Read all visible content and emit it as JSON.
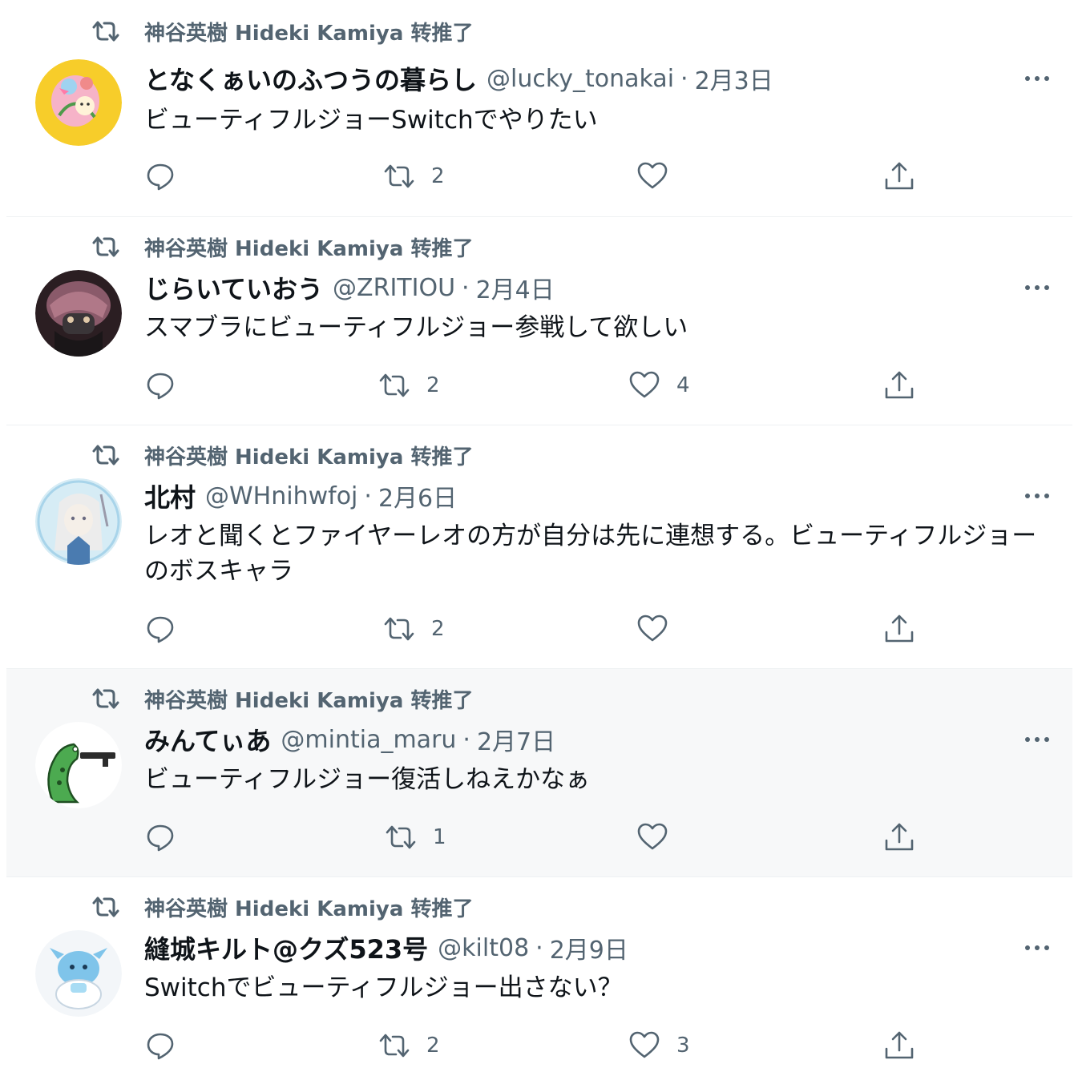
{
  "colors": {
    "secondary_text": "#536471",
    "primary_text": "#0f1419",
    "divider": "#eef1f3",
    "hover_bg": "#f7f8f9"
  },
  "icons": {
    "retweet": "retweet-icon",
    "reply": "reply-icon",
    "like": "heart-icon",
    "share": "share-icon",
    "more": "more-icon"
  },
  "tweets": [
    {
      "retweeted_by": "神谷英樹 Hideki Kamiya 转推了",
      "display_name": "となくぁいのふつうの暮らし",
      "handle": "@lucky_tonakai",
      "separator": "·",
      "date": "2月3日",
      "text": "ビューティフルジョーSwitchでやりたい",
      "retweets": "2",
      "likes": ""
    },
    {
      "retweeted_by": "神谷英樹 Hideki Kamiya 转推了",
      "display_name": "じらいていおう",
      "handle": "@ZRITIOU",
      "separator": "·",
      "date": "2月4日",
      "text": "スマブラにビューティフルジョー参戦して欲しい",
      "retweets": "2",
      "likes": "4"
    },
    {
      "retweeted_by": "神谷英樹 Hideki Kamiya 转推了",
      "display_name": "北村",
      "handle": "@WHnihwfoj",
      "separator": "·",
      "date": "2月6日",
      "text": "レオと聞くとファイヤーレオの方が自分は先に連想する。ビューティフルジョーのボスキャラ",
      "retweets": "2",
      "likes": ""
    },
    {
      "retweeted_by": "神谷英樹 Hideki Kamiya 转推了",
      "display_name": "みんてぃあ",
      "handle": "@mintia_maru",
      "separator": "·",
      "date": "2月7日",
      "text": "ビューティフルジョー復活しねえかなぁ",
      "retweets": "1",
      "likes": ""
    },
    {
      "retweeted_by": "神谷英樹 Hideki Kamiya 转推了",
      "display_name": "縫城キルト@クズ523号",
      "handle": "@kilt08",
      "separator": "·",
      "date": "2月9日",
      "text": "Switchでビューティフルジョー出さない？",
      "retweets": "2",
      "likes": "3"
    }
  ]
}
